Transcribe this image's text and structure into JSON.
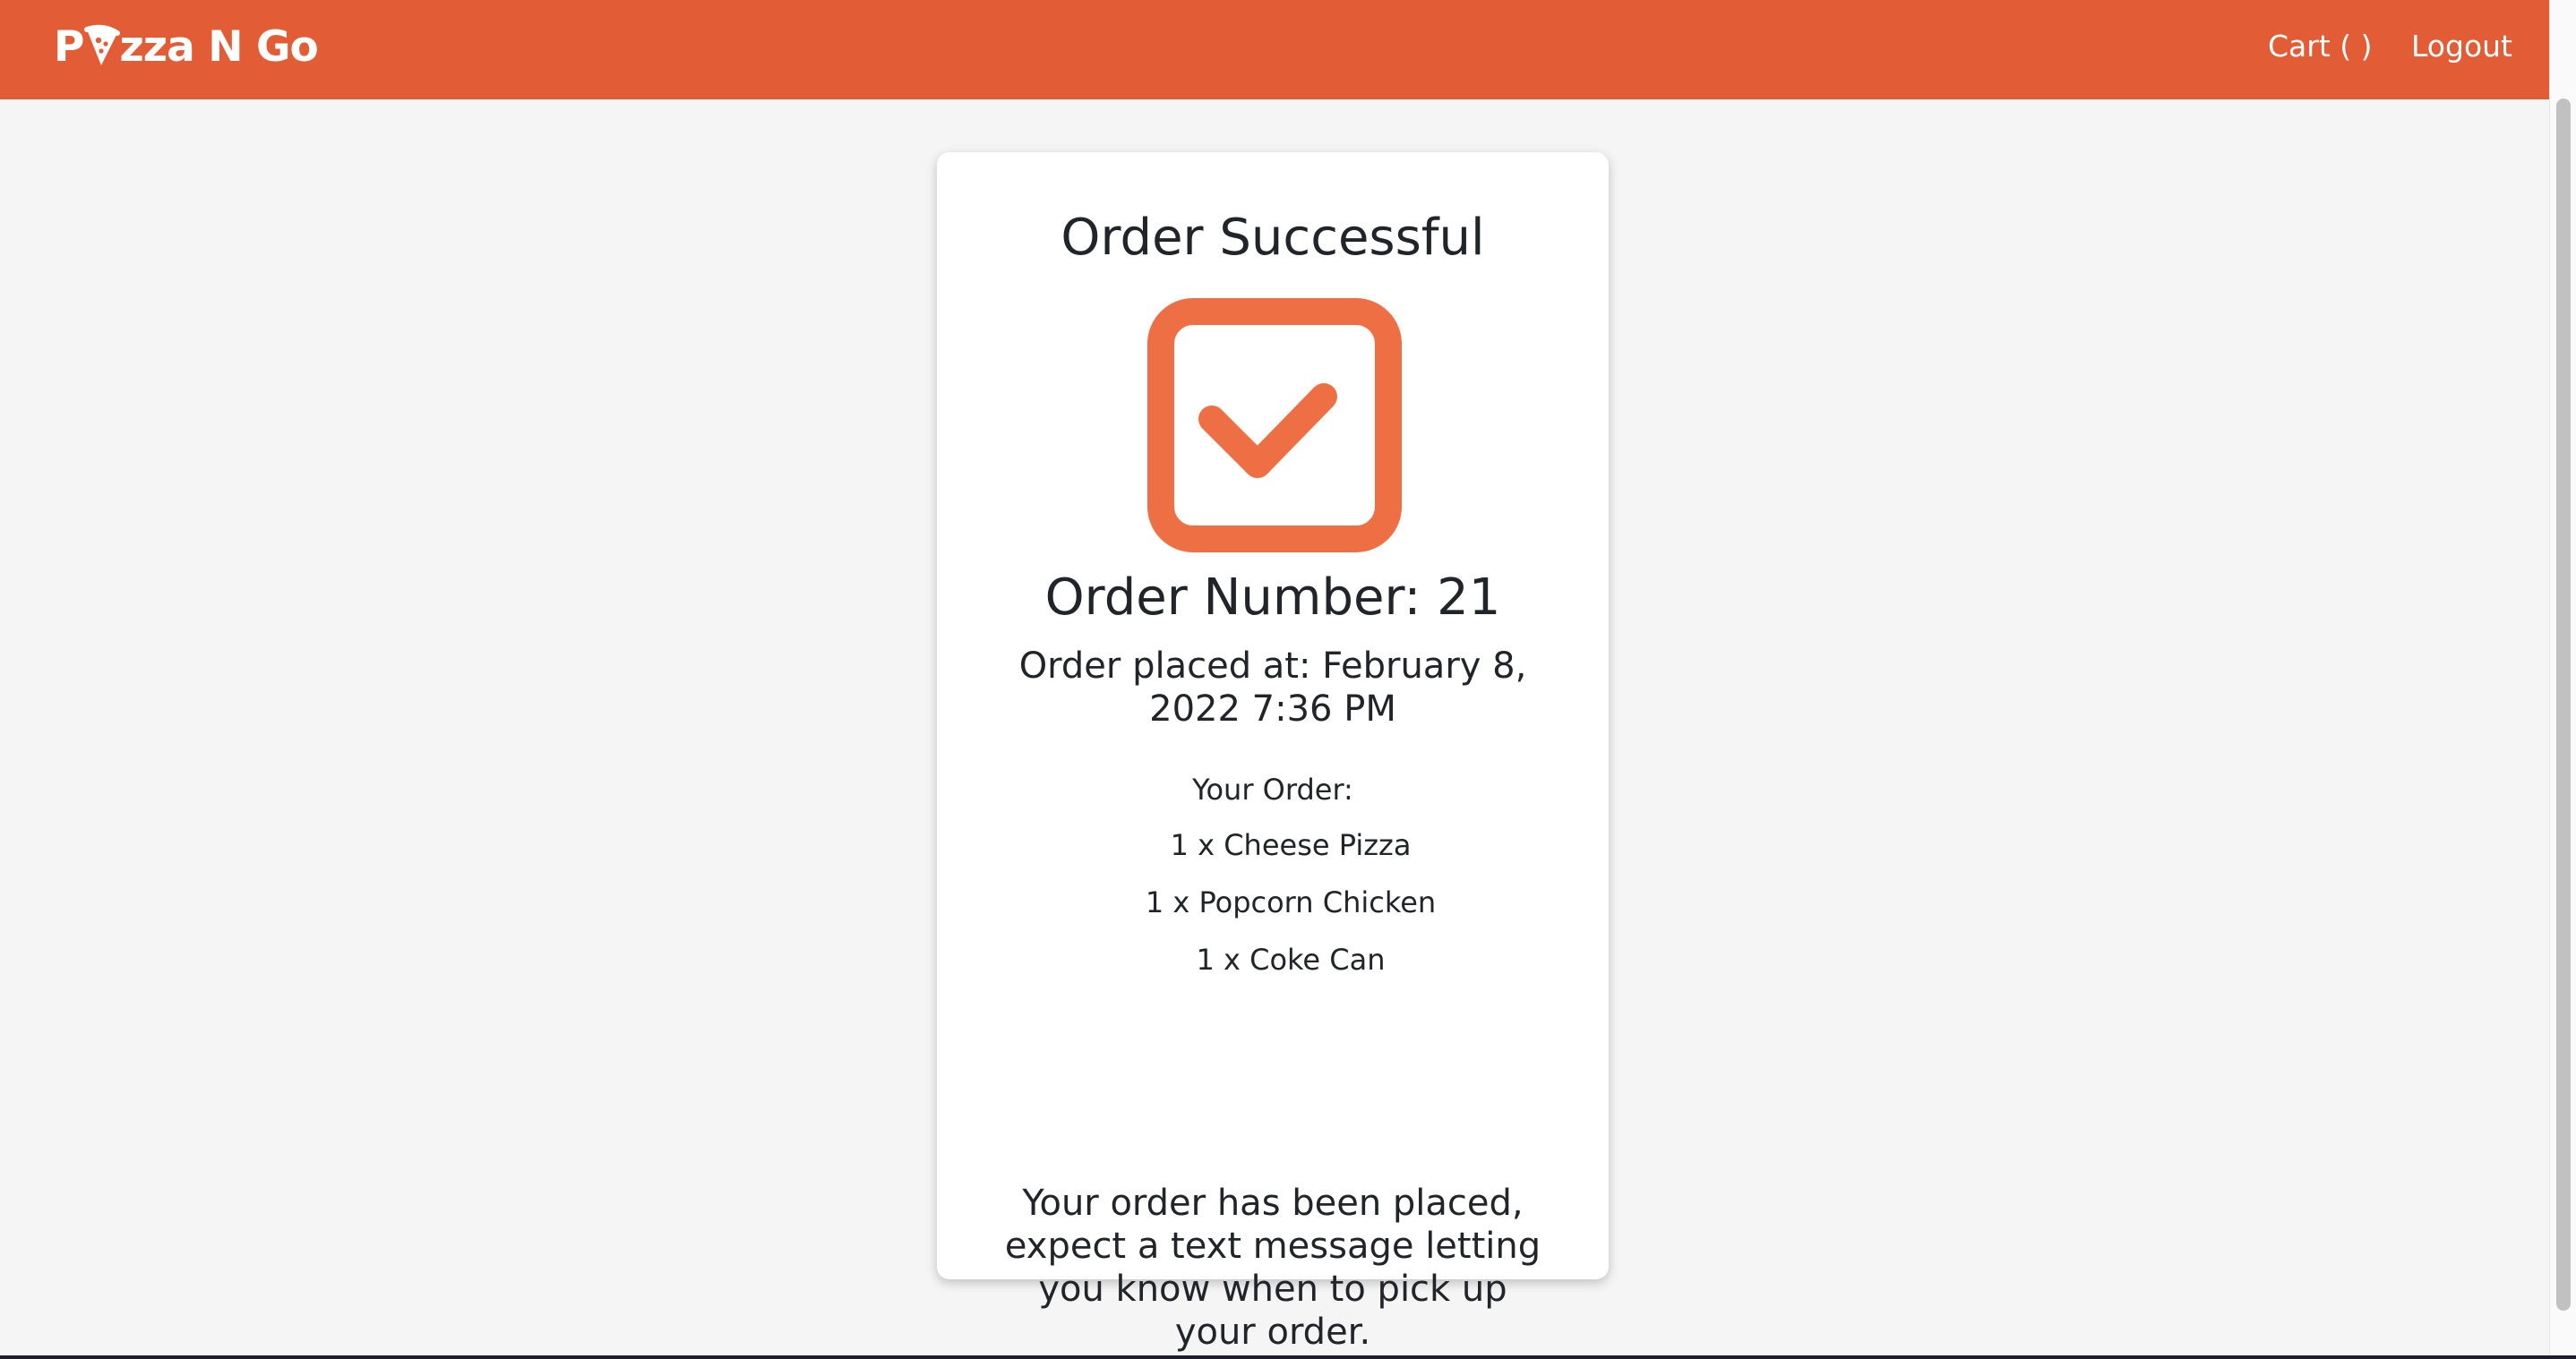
{
  "navbar": {
    "brand_prefix": "P",
    "brand_suffix": "zza N Go",
    "cart_label": "Cart ( )",
    "logout_label": "Logout",
    "color": "#e25c35"
  },
  "order": {
    "title": "Order Successful",
    "status_icon": "checkbox-check-icon",
    "number_text": "Order Number: 21",
    "placed_at_text": "Order placed at: February 8, 2022 7:36 PM",
    "your_order_label": "Your Order:",
    "items": [
      "1 x Cheese Pizza",
      "1 x Popcorn Chicken",
      "1 x Coke Can"
    ],
    "message": "Your order has been placed, expect a text message letting you know when to pick up your order.",
    "accent_color": "#ef6f45"
  }
}
